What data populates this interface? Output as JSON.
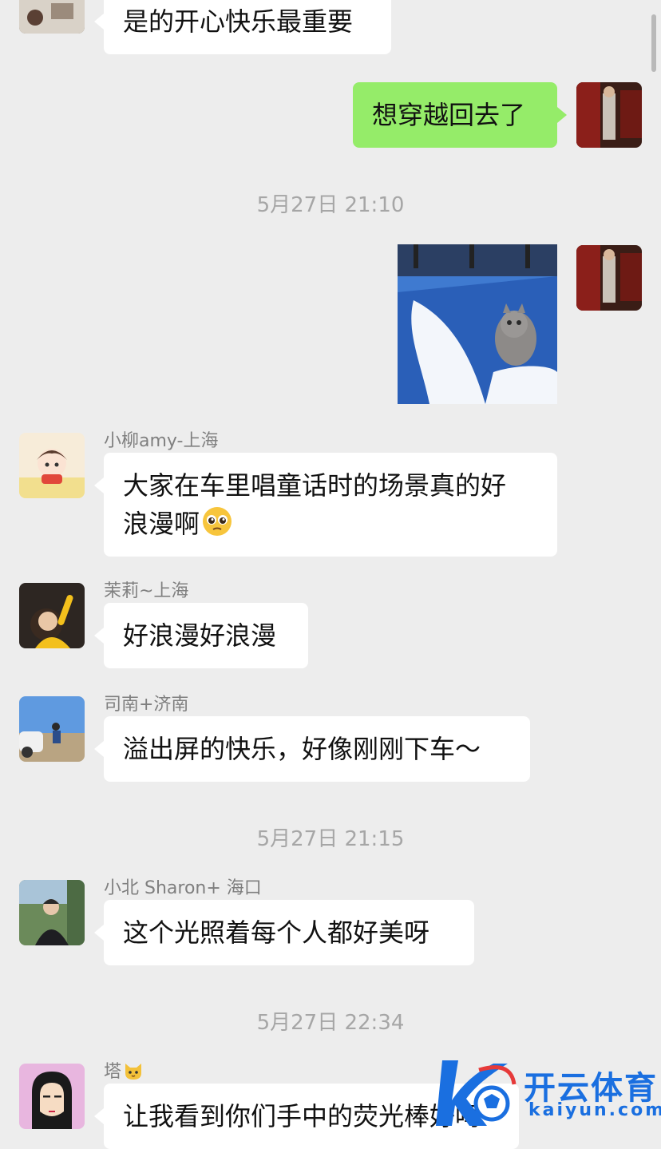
{
  "messages": {
    "m1": {
      "text": "是的开心快乐最重要"
    },
    "m2": {
      "text": "想穿越回去了"
    },
    "m4": {
      "sender": "小柳amy-上海",
      "text": "大家在车里唱童话时的场景真的好",
      "text2": "浪漫啊"
    },
    "m5": {
      "sender": "茉莉~上海",
      "text": "好浪漫好浪漫"
    },
    "m6": {
      "sender": "司南+济南",
      "text": "溢出屏的快乐，好像刚刚下车～"
    },
    "m7": {
      "sender": "小北 Sharon+ 海口",
      "text": "这个光照着每个人都好美呀"
    },
    "m8": {
      "sender": "塔",
      "text": "让我看到你们手中的荧光棒好吗"
    }
  },
  "timestamps": {
    "t1": "5月27日 21:10",
    "t2": "5月27日 21:15",
    "t3": "5月27日 22:34"
  },
  "watermark": {
    "cn": "开云体育",
    "en": "kaiyun.com"
  },
  "colors": {
    "background": "#ededed",
    "my_bubble": "#95ec69",
    "other_bubble": "#ffffff",
    "brand": "#1a6fe0"
  }
}
